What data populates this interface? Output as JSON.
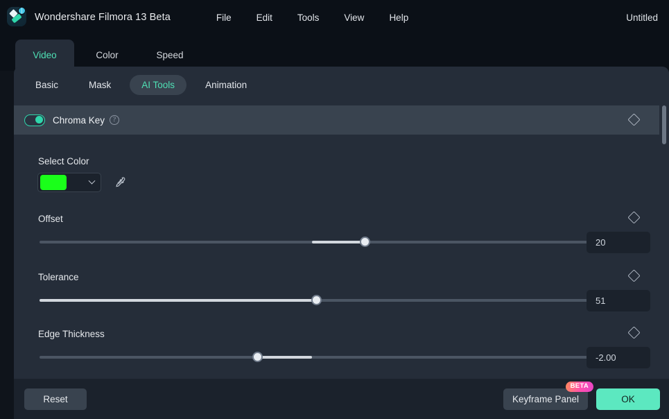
{
  "titlebar": {
    "logo_icon": "filmora-logo-icon",
    "app_title": "Wondershare Filmora 13 Beta",
    "menu": [
      "File",
      "Edit",
      "Tools",
      "View",
      "Help"
    ],
    "document_name": "Untitled"
  },
  "tabs": [
    {
      "label": "Video",
      "active": true
    },
    {
      "label": "Color",
      "active": false
    },
    {
      "label": "Speed",
      "active": false
    }
  ],
  "subtabs": [
    {
      "label": "Basic",
      "active": false
    },
    {
      "label": "Mask",
      "active": false
    },
    {
      "label": "AI Tools",
      "active": true
    },
    {
      "label": "Animation",
      "active": false
    }
  ],
  "section": {
    "title": "Chroma Key",
    "toggle_on": true,
    "help_icon": "question-mark-icon",
    "keyframe_icon": "keyframe-diamond-icon"
  },
  "color": {
    "label": "Select Color",
    "swatch_hex": "#1aff1a",
    "dropdown_icon": "chevron-down-icon",
    "picker_icon": "eyedropper-icon"
  },
  "sliders": [
    {
      "label": "Offset",
      "value": "20",
      "thumb_pct": 59.4,
      "fill_start_pct": 49.7,
      "fill_end_pct": 59.4,
      "keyframe_icon": "keyframe-diamond-icon"
    },
    {
      "label": "Tolerance",
      "value": "51",
      "thumb_pct": 50.5,
      "fill_start_pct": 0,
      "fill_end_pct": 50.5,
      "keyframe_icon": "keyframe-diamond-icon"
    },
    {
      "label": "Edge Thickness",
      "value": "-2.00",
      "thumb_pct": 39.8,
      "fill_start_pct": 39.8,
      "fill_end_pct": 49.7,
      "keyframe_icon": "keyframe-diamond-icon"
    }
  ],
  "footer": {
    "reset_label": "Reset",
    "keyframe_label": "Keyframe Panel",
    "beta_label": "BETA",
    "ok_label": "OK"
  },
  "colors": {
    "accent_teal": "#4fe0b5",
    "ok_button": "#5ce8c0",
    "panel_bg": "#252d39",
    "header_bg": "#39434f",
    "chroma_green": "#1aff1a"
  }
}
